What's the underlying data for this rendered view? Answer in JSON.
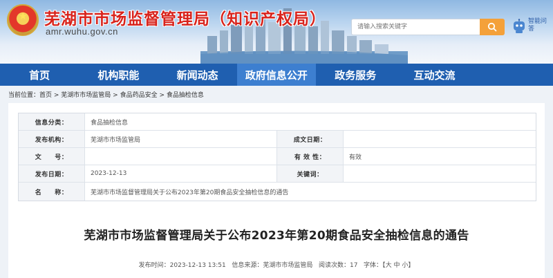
{
  "header": {
    "title": "芜湖市市场监督管理局（知识产权局）",
    "url": "amr.wuhu.gov.cn",
    "search_placeholder": "请输入搜索关键字",
    "robot_label": "智能问答"
  },
  "nav": {
    "items": [
      "首页",
      "机构职能",
      "新闻动态",
      "政府信息公开",
      "政务服务",
      "互动交流"
    ],
    "active_index": 3
  },
  "breadcrumb": {
    "prefix": "当前位置：",
    "items": [
      "首页",
      "芜湖市市场监管局",
      "食品药品安全",
      "食品抽检信息"
    ],
    "separator": " > "
  },
  "info": {
    "category_label": "信息分类：",
    "category_value": "食品抽检信息",
    "publisher_label": "发布机构：",
    "publisher_value": "芜湖市市场监管局",
    "created_label": "成文日期：",
    "created_value": "",
    "docno_label": "文　　号：",
    "docno_value": "",
    "validity_label": "有 效 性：",
    "validity_value": "有效",
    "date_label": "发布日期：",
    "date_value": "2023-12-13",
    "keywords_label": "关键词：",
    "keywords_value": "",
    "name_label": "名　　称：",
    "name_value": "芜湖市市场监督管理局关于公布2023年第20期食品安全抽检信息的通告"
  },
  "article": {
    "title": "芜湖市市场监督管理局关于公布2023年第20期食品安全抽检信息的通告",
    "meta_time_label": "发布时间：",
    "meta_time": "2023-12-13 13:51",
    "meta_source_label": "信息来源：",
    "meta_source": "芜湖市市场监管局",
    "meta_views_label": "阅读次数：",
    "meta_views": "17",
    "meta_size_label": "字体：",
    "size_large": "大",
    "size_medium": "中",
    "size_small": "小"
  },
  "colors": {
    "nav_bg": "#1f5fb0",
    "nav_active": "#3d7fd0",
    "title_red": "#d8231c",
    "search_button": "#f4a13a"
  }
}
